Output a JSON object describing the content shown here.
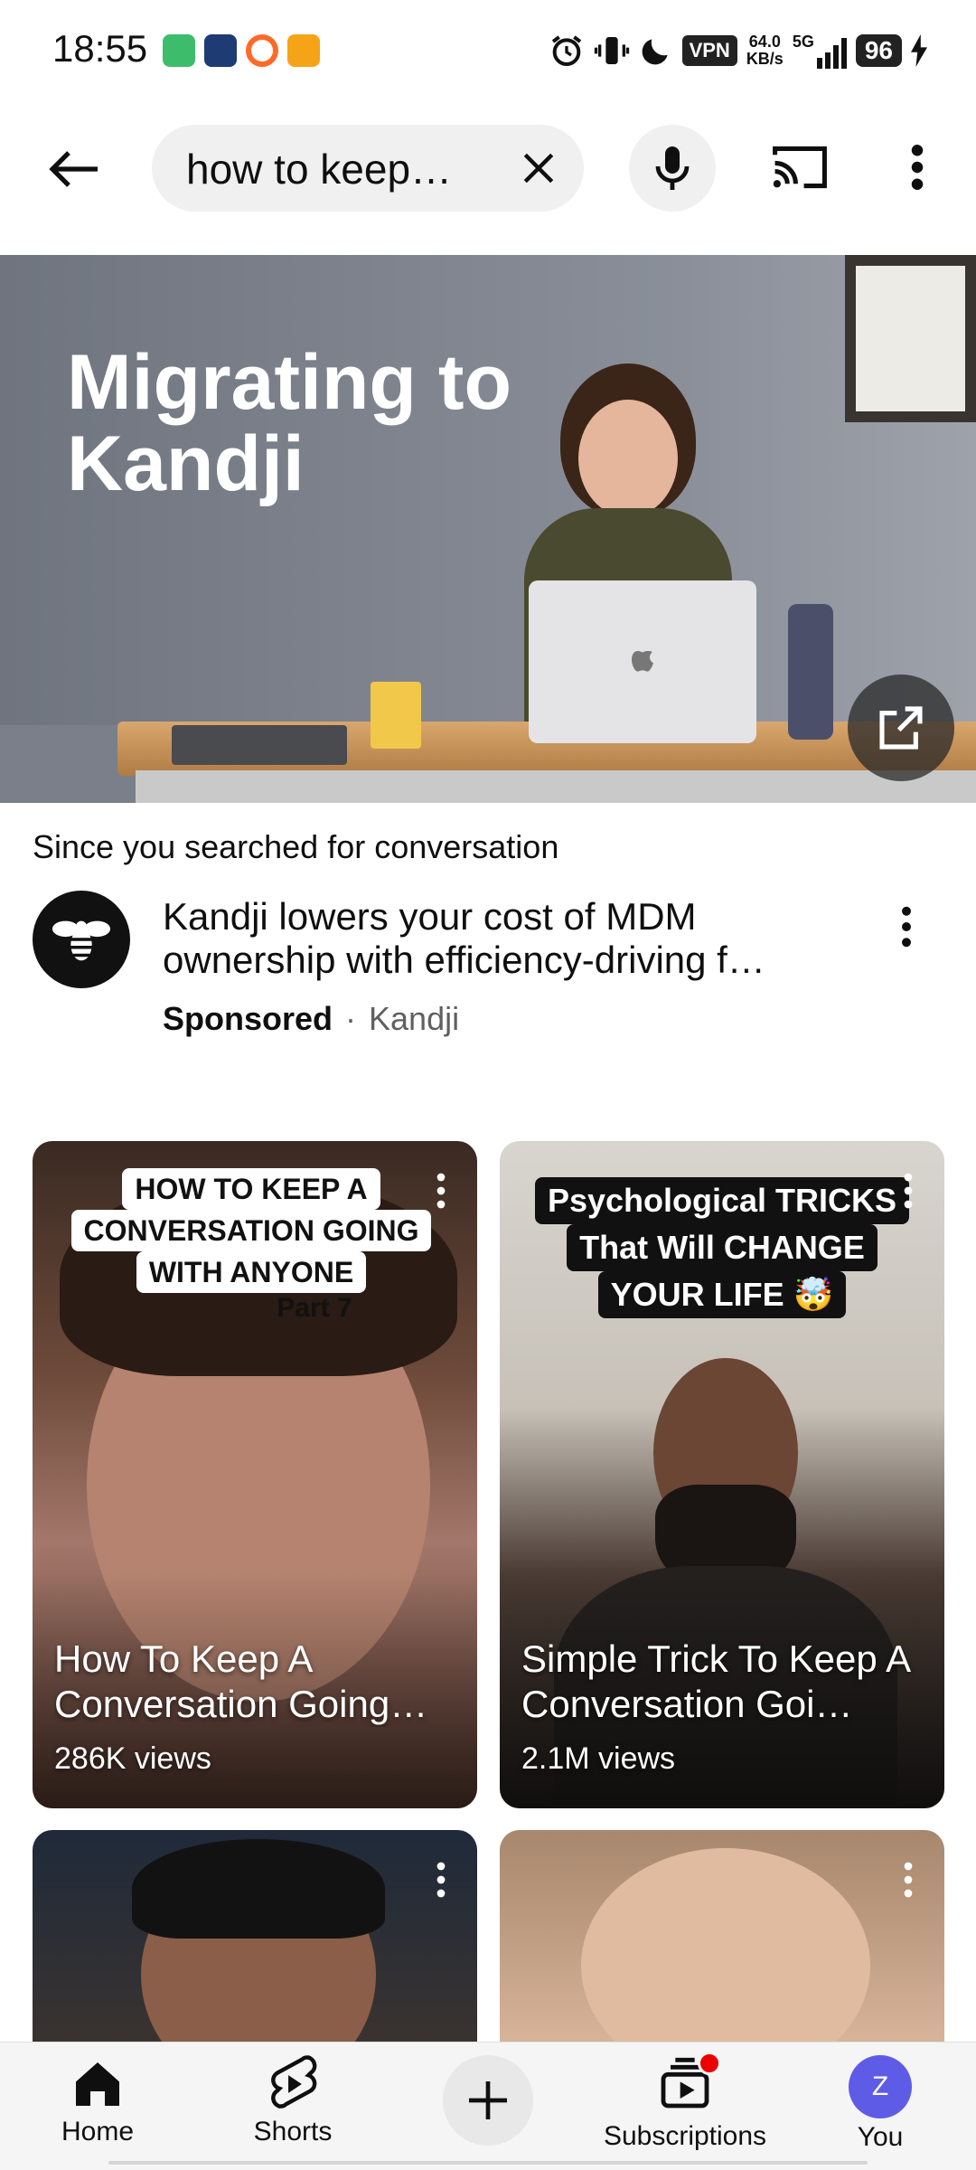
{
  "status_bar": {
    "time": "18:55",
    "vpn": "VPN",
    "net_speed_value": "64.0",
    "net_speed_unit": "KB/s",
    "network": "5G",
    "battery": "96"
  },
  "header": {
    "search_query": "how to keep…"
  },
  "ad": {
    "hero_title": "Migrating to Kandji",
    "since_prefix": "Since you searched for ",
    "since_term": "conversation",
    "title": "Kandji lowers your cost of MDM ownership with efficiency-driving f…",
    "sponsored": "Sponsored",
    "separator": "·",
    "advertiser": "Kandji"
  },
  "shorts": [
    {
      "caption_lines": [
        "HOW TO KEEP A",
        "CONVERSATION GOING",
        "WITH ANYONE"
      ],
      "caption_sub": "Part 7",
      "title": "How To Keep A Conversation Going…",
      "views": "286K views"
    },
    {
      "caption_lines": [
        "Psychological TRICKS",
        "That Will CHANGE",
        "YOUR LIFE 🤯"
      ],
      "title": "Simple Trick To Keep A Conversation Goi…",
      "views": "2.1M views"
    }
  ],
  "bottom_nav": {
    "home": "Home",
    "shorts": "Shorts",
    "subscriptions": "Subscriptions",
    "you": "You",
    "you_initial": "Z"
  },
  "colors": {
    "accent_red": "#ff0000",
    "avatar": "#5e5ce6"
  }
}
